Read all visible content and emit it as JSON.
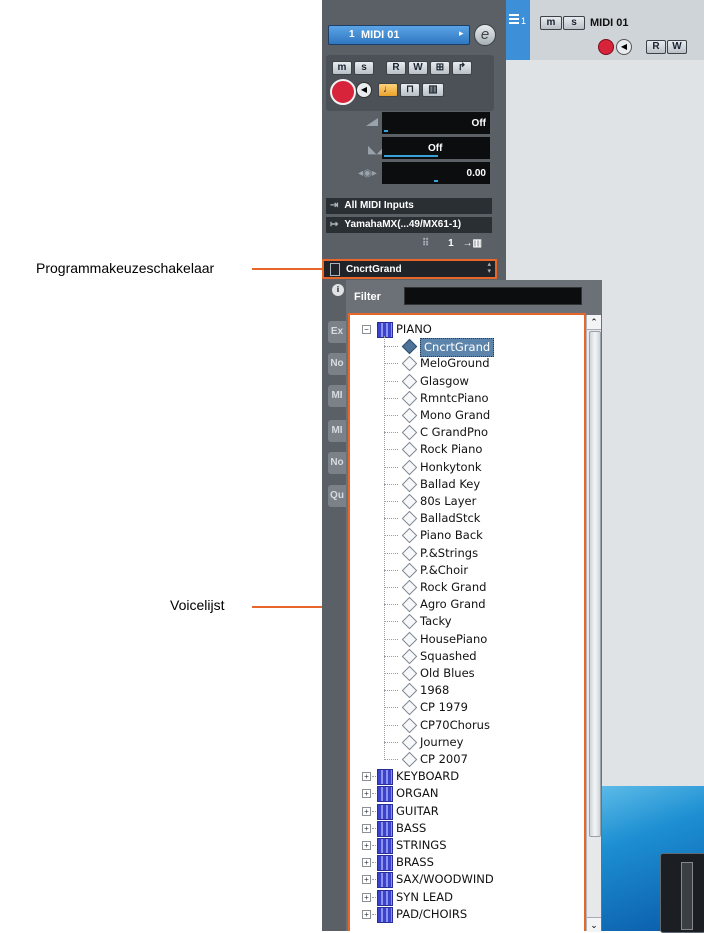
{
  "callouts": {
    "program_selector": "Programmakeuzeschakelaar",
    "voice_list": "Voicelijst"
  },
  "track": {
    "number": "1",
    "name": "MIDI 01",
    "edit_glyph": "e"
  },
  "buttons": {
    "mute": "m",
    "solo": "s",
    "read": "R",
    "write": "W"
  },
  "fields": {
    "transpose_value": "Off",
    "velocity_value": "Off",
    "pan_value": "0.00"
  },
  "io": {
    "input": "All MIDI Inputs",
    "output": "YamahaMX(...49/MX61-1)",
    "channel": "1"
  },
  "program": {
    "selected": "CncrtGrand"
  },
  "filter": {
    "label": "Filter",
    "value": ""
  },
  "side_buttons": [
    "Ex",
    "No",
    "MI",
    "MI",
    "No",
    "Qu"
  ],
  "tree": {
    "expanded_category": "PIANO",
    "voices": [
      "CncrtGrand",
      "MeloGround",
      "Glasgow",
      "RmntcPiano",
      "Mono Grand",
      "C GrandPno",
      "Rock Piano",
      "Honkytonk",
      "Ballad Key",
      "80s Layer",
      "BalladStck",
      "Piano Back",
      "P.&Strings",
      "P.&Choir",
      "Rock Grand",
      "Agro Grand",
      "Tacky",
      "HousePiano",
      "Squashed",
      "Old Blues",
      "1968",
      "CP 1979",
      "CP70Chorus",
      "Journey",
      "CP 2007"
    ],
    "collapsed_categories": [
      "KEYBOARD",
      "ORGAN",
      "GUITAR",
      "BASS",
      "STRINGS",
      "BRASS",
      "SAX/WOODWIND",
      "SYN LEAD",
      "PAD/CHOIRS"
    ]
  },
  "arrange_track": {
    "number": "1",
    "name": "MIDI 01"
  },
  "colors": {
    "accent": "#e8662a",
    "track_blue": "#3d8fd8",
    "record_red": "#d8243a",
    "category_icon": "#3a43c9"
  }
}
